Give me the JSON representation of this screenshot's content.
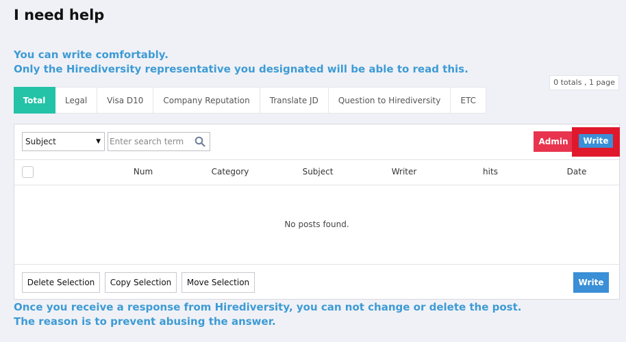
{
  "page": {
    "title": "I need help",
    "intro_line1": "You can write comfortably.",
    "intro_line2": "Only the Hirediversity representative you designated will be able to read this.",
    "page_info": "0 totals , 1 page"
  },
  "tabs": [
    {
      "label": "Total",
      "active": true
    },
    {
      "label": "Legal",
      "active": false
    },
    {
      "label": "Visa D10",
      "active": false
    },
    {
      "label": "Company Reputation",
      "active": false
    },
    {
      "label": "Translate JD",
      "active": false
    },
    {
      "label": "Question to Hirediversity",
      "active": false
    },
    {
      "label": "ETC",
      "active": false
    }
  ],
  "toolbar": {
    "select_value": "Subject",
    "search_placeholder": "Enter search term",
    "search_icon": "search-icon",
    "admin_label": "Admin",
    "write_label": "Write"
  },
  "table": {
    "columns": [
      "Num",
      "Category",
      "Subject",
      "Writer",
      "hits",
      "Date"
    ],
    "empty_message": "No posts found."
  },
  "footer": {
    "delete_label": "Delete Selection",
    "copy_label": "Copy Selection",
    "move_label": "Move Selection",
    "write_label": "Write"
  },
  "notice": {
    "line1": "Once you receive a response from Hirediversity, you can not change or delete the post.",
    "line2": "The reason is to prevent abusing the answer."
  },
  "colors": {
    "accent_tab": "#24c2a7",
    "admin_button": "#e8344e",
    "write_button": "#3a8fd6",
    "highlight": "#e0182c",
    "info_text": "#3d9bd5"
  }
}
